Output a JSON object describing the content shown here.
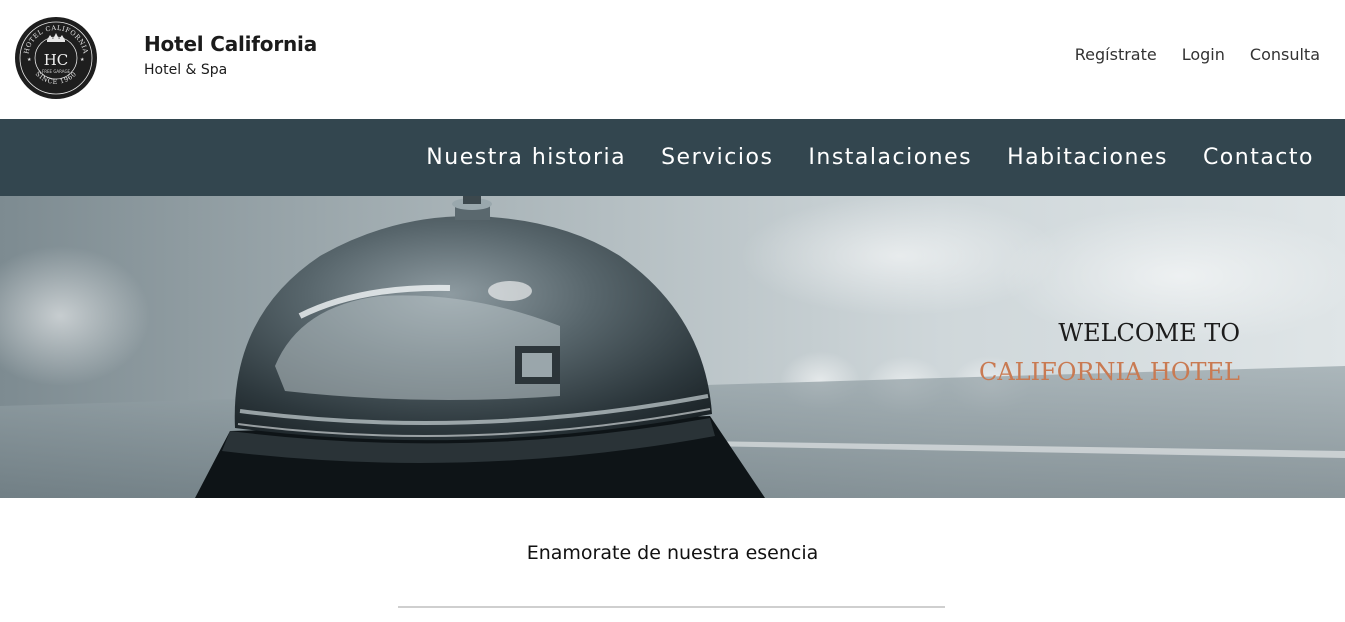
{
  "logo": {
    "top_text": "HOTEL CALIFORNIA",
    "monogram": "HC",
    "mid_text": "FREE GARAGE",
    "bottom_text": "SINCE 1960"
  },
  "brand": {
    "title": "Hotel California",
    "subtitle": "Hotel & Spa"
  },
  "top_links": [
    {
      "label": "Regístrate"
    },
    {
      "label": "Login"
    },
    {
      "label": "Consulta"
    }
  ],
  "nav": [
    {
      "label": "Nuestra historia"
    },
    {
      "label": "Servicios"
    },
    {
      "label": "Instalaciones"
    },
    {
      "label": "Habitaciones"
    },
    {
      "label": "Contacto"
    }
  ],
  "hero": {
    "line1": "WELCOME TO",
    "line2": "CALIFORNIA HOTEL"
  },
  "tagline": "Enamorate de nuestra esencia",
  "colors": {
    "nav_bg": "#33464f",
    "accent": "#c97a52"
  }
}
